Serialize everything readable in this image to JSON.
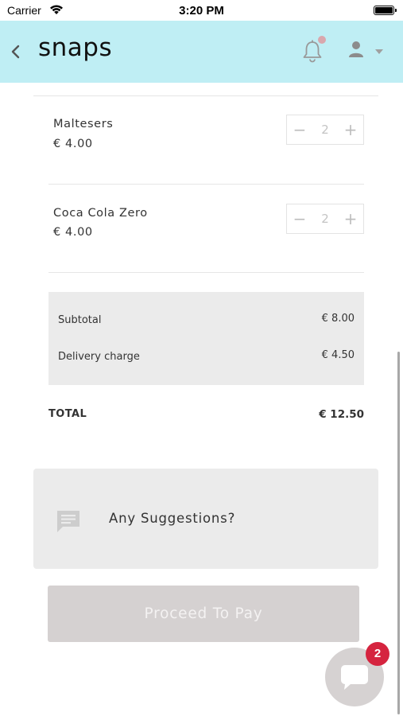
{
  "status_bar": {
    "carrier": "Carrier",
    "time": "3:20 PM"
  },
  "header": {
    "logo": "snaps",
    "back_icon": "chevron-left-icon",
    "notification_icon": "bell-icon",
    "user_icon": "user-icon",
    "background_color": "#bfeef4"
  },
  "cart": {
    "items": [
      {
        "name": "Maltesers",
        "price": "€ 4.00",
        "quantity": "2",
        "minus": "−",
        "plus": "+"
      },
      {
        "name": "Coca Cola Zero",
        "price": "€ 4.00",
        "quantity": "2",
        "minus": "−",
        "plus": "+"
      }
    ]
  },
  "summary": {
    "subtotal_label": "Subtotal",
    "subtotal_value": "€ 8.00",
    "delivery_label": "Delivery charge",
    "delivery_value": "€ 4.50",
    "total_label": "TOTAL",
    "total_value": "€ 12.50"
  },
  "suggestions": {
    "label": "Any Suggestions?",
    "icon": "message-icon"
  },
  "pay_button": {
    "label": "Proceed To Pay",
    "color": "#d5d1d1"
  },
  "chat": {
    "badge": "2",
    "icon": "chat-icon",
    "badge_color": "#d5243f"
  }
}
